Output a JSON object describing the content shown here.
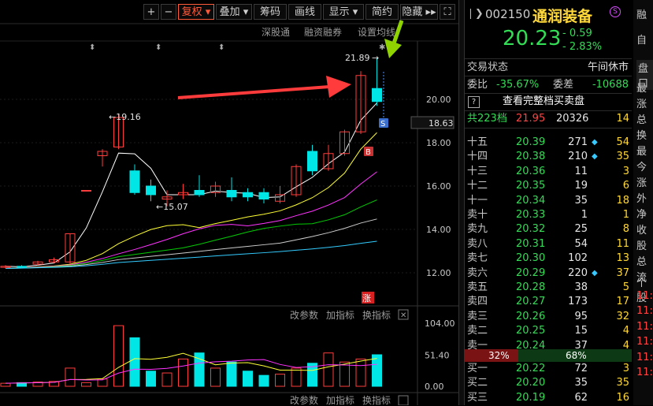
{
  "toolbar": {
    "buttons": [
      "+",
      "−",
      "复权 ▾",
      "叠加 ▾",
      "筹码",
      "画线",
      "显示 ▾",
      "简约",
      "隐藏 ▸▸",
      "⛶"
    ],
    "sub": [
      "深股通",
      "融资融券",
      "设置均线"
    ]
  },
  "chart": {
    "y_ticks": [
      "20.00",
      "18.00",
      "16.00",
      "14.00",
      "12.00"
    ],
    "current_price_tag": "18.63",
    "annotations": {
      "high": "21.89",
      "mark_high": "←19.16",
      "mark_low": "←15.07"
    },
    "badges": {
      "b": "B",
      "s": "S",
      "zhang": "涨"
    },
    "indicator_bar": [
      "改参数",
      "加指标",
      "换指标"
    ],
    "vol_ticks": [
      "104.00",
      "51.40",
      "0.00"
    ]
  },
  "chart_data": {
    "type": "candlestick",
    "candles": [
      {
        "o": 12.25,
        "c": 12.3,
        "h": 12.35,
        "l": 12.2
      },
      {
        "o": 12.3,
        "c": 12.25,
        "h": 12.35,
        "l": 12.2
      },
      {
        "o": 12.4,
        "c": 12.5,
        "h": 12.55,
        "l": 12.35
      },
      {
        "o": 12.5,
        "c": 12.6,
        "h": 12.7,
        "l": 12.45
      },
      {
        "o": 12.5,
        "c": 13.8,
        "h": 13.8,
        "l": 12.4
      },
      {
        "o": 15.8,
        "c": 15.8,
        "h": 15.8,
        "l": 15.8
      },
      {
        "o": 17.4,
        "c": 17.6,
        "h": 17.7,
        "l": 16.9
      },
      {
        "o": 17.8,
        "c": 19.16,
        "h": 19.3,
        "l": 17.7
      },
      {
        "o": 16.7,
        "c": 15.7,
        "h": 17.0,
        "l": 15.6
      },
      {
        "o": 16.0,
        "c": 15.6,
        "h": 16.3,
        "l": 15.3
      },
      {
        "o": 15.4,
        "c": 15.5,
        "h": 15.8,
        "l": 15.07
      },
      {
        "o": 15.6,
        "c": 15.7,
        "h": 16.1,
        "l": 15.4
      },
      {
        "o": 15.8,
        "c": 15.6,
        "h": 16.5,
        "l": 15.5
      },
      {
        "o": 15.7,
        "c": 16.0,
        "h": 16.2,
        "l": 15.5
      },
      {
        "o": 15.8,
        "c": 15.5,
        "h": 16.4,
        "l": 15.3
      },
      {
        "o": 15.7,
        "c": 15.5,
        "h": 15.9,
        "l": 15.3
      },
      {
        "o": 15.7,
        "c": 15.4,
        "h": 15.9,
        "l": 15.2
      },
      {
        "o": 15.3,
        "c": 15.6,
        "h": 16.0,
        "l": 15.2
      },
      {
        "o": 15.6,
        "c": 16.9,
        "h": 17.0,
        "l": 15.5
      },
      {
        "o": 17.6,
        "c": 16.7,
        "h": 17.9,
        "l": 16.5
      },
      {
        "o": 16.8,
        "c": 17.5,
        "h": 17.9,
        "l": 16.7
      },
      {
        "o": 17.5,
        "c": 18.5,
        "h": 18.6,
        "l": 17.4
      },
      {
        "o": 18.5,
        "c": 21.1,
        "h": 21.3,
        "l": 18.4
      },
      {
        "o": 20.5,
        "c": 19.9,
        "h": 21.89,
        "l": 19.7
      }
    ],
    "volume": [
      5,
      6,
      7,
      8,
      30,
      6,
      12,
      100,
      80,
      25,
      22,
      45,
      55,
      30,
      40,
      25,
      18,
      20,
      30,
      38,
      55,
      40,
      45,
      52
    ],
    "ylim": [
      12,
      22
    ],
    "vol_ylim": [
      0,
      104
    ]
  },
  "quote": {
    "code": "002150",
    "name": "通润装备",
    "price": "20.23",
    "change": "- 0.59",
    "pct": "- 2.83%",
    "status_label": "交易状态",
    "status_value": "午间休市",
    "weibi_label": "委比",
    "weibi_value": "-35.67%",
    "weicha_label": "委差",
    "weicha_value": "-10688",
    "full_book": "查看完整档买卖盘",
    "levels_label": "共223档",
    "levels_price": "21.95",
    "levels_vol": "20326",
    "levels_ord": "14"
  },
  "asks": [
    {
      "label": "十五",
      "price": "20.39",
      "vol": "271",
      "dot": "◆",
      "ord": "54"
    },
    {
      "label": "十四",
      "price": "20.38",
      "vol": "210",
      "dot": "◆",
      "ord": "35"
    },
    {
      "label": "十三",
      "price": "20.36",
      "vol": "11",
      "dot": "",
      "ord": "3"
    },
    {
      "label": "十二",
      "price": "20.35",
      "vol": "19",
      "dot": "",
      "ord": "6"
    },
    {
      "label": "十一",
      "price": "20.34",
      "vol": "35",
      "dot": "",
      "ord": "18"
    },
    {
      "label": "卖十",
      "price": "20.33",
      "vol": "1",
      "dot": "",
      "ord": "1"
    },
    {
      "label": "卖九",
      "price": "20.32",
      "vol": "25",
      "dot": "",
      "ord": "8"
    },
    {
      "label": "卖八",
      "price": "20.31",
      "vol": "54",
      "dot": "",
      "ord": "11"
    },
    {
      "label": "卖七",
      "price": "20.30",
      "vol": "102",
      "dot": "",
      "ord": "13"
    },
    {
      "label": "卖六",
      "price": "20.29",
      "vol": "220",
      "dot": "◆",
      "ord": "37"
    },
    {
      "label": "卖五",
      "price": "20.28",
      "vol": "38",
      "dot": "",
      "ord": "5"
    },
    {
      "label": "卖四",
      "price": "20.27",
      "vol": "173",
      "dot": "",
      "ord": "17"
    },
    {
      "label": "卖三",
      "price": "20.26",
      "vol": "95",
      "dot": "",
      "ord": "32"
    },
    {
      "label": "卖二",
      "price": "20.25",
      "vol": "15",
      "dot": "",
      "ord": "4"
    },
    {
      "label": "卖一",
      "price": "20.24",
      "vol": "37",
      "dot": "",
      "ord": "4"
    }
  ],
  "ratio": {
    "buy_pct": "32%",
    "sell_pct": "68%",
    "buy_frac": 0.32
  },
  "bids": [
    {
      "label": "买一",
      "price": "20.22",
      "vol": "72",
      "dot": "",
      "ord": "3"
    },
    {
      "label": "买二",
      "price": "20.20",
      "vol": "35",
      "dot": "",
      "ord": "35"
    },
    {
      "label": "买三",
      "price": "20.19",
      "vol": "62",
      "dot": "",
      "ord": "16"
    }
  ],
  "side": {
    "items": [
      "融",
      "自",
      "盘口",
      "最",
      "涨",
      "总",
      "换",
      "最",
      "今",
      "涨",
      "外",
      "净",
      "收",
      "股",
      "总",
      "流",
      "个股",
      "11:",
      "11:",
      "11:",
      "11:",
      "11:",
      "11:"
    ]
  },
  "colors": {
    "up": "#ff3c3c",
    "down": "#00e5e5",
    "ma5": "#ffffff",
    "ma10": "#ffff33",
    "ma20": "#ff33ff",
    "ma30": "#00cc00",
    "ma60": "#cccccc",
    "ma120": "#33ccff",
    "arrow_red": "#ff3b3b",
    "arrow_green": "#8fd400"
  }
}
